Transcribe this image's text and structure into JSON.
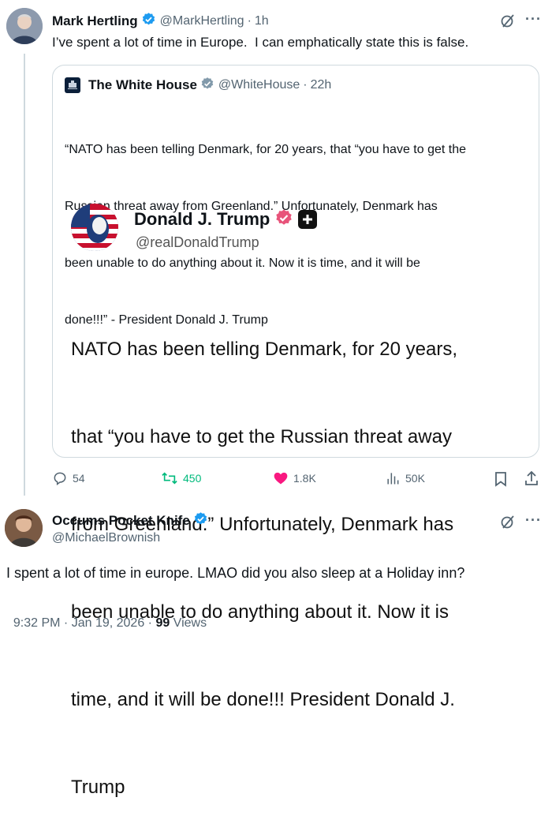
{
  "main_post": {
    "author_name": "Mark Hertling",
    "author_handle": "@MarkHertling",
    "sep": "·",
    "time": "1h",
    "text": "I’ve spent a lot of time in Europe.  I can emphatically state this is false."
  },
  "quoted_post": {
    "author_name": "The White House",
    "author_handle": "@WhiteHouse",
    "sep": "·",
    "time": "22h",
    "text_lines": [
      "“NATO has been telling Denmark, for 20 years, that “you have to get the",
      "Russian threat away from Greenland.” Unfortunately, Denmark has",
      "been unable to do anything about it. Now it is time, and it will be",
      "done!!!” - President Donald J. Trump"
    ],
    "embedded": {
      "author_name": "Donald J. Trump",
      "author_handle": "@realDonaldTrump",
      "text_lines": [
        "NATO has been telling Denmark, for 20 years,",
        "that “you have to get the Russian threat away",
        "from Greenland.” Unfortunately, Denmark has",
        "been unable to do anything about it. Now it is",
        "time, and it will be done!!! President Donald J.",
        "Trump"
      ]
    }
  },
  "actions": {
    "replies": "54",
    "reposts": "450",
    "likes": "1.8K",
    "views": "50K"
  },
  "reply_post": {
    "author_name": "Occums Pocket Knife",
    "author_handle": "@MichaelBrownish",
    "text": "I spent a lot of time in europe. LMAO did you also sleep at a Holiday inn?",
    "timestamp": "9:32 PM · Jan 19, 2026 · ",
    "views_count": "99",
    "views_label": " Views"
  },
  "colors": {
    "verified_blue": "#1d9bf0",
    "like_pink": "#f91880",
    "repost_green": "#00ba7c",
    "trump_badge": "#e8537a"
  },
  "icons": [
    "verified-badge-icon",
    "grok-icon",
    "more-icon",
    "reply-icon",
    "repost-icon",
    "like-icon",
    "views-icon",
    "bookmark-icon",
    "share-icon",
    "plus-badge-icon"
  ]
}
